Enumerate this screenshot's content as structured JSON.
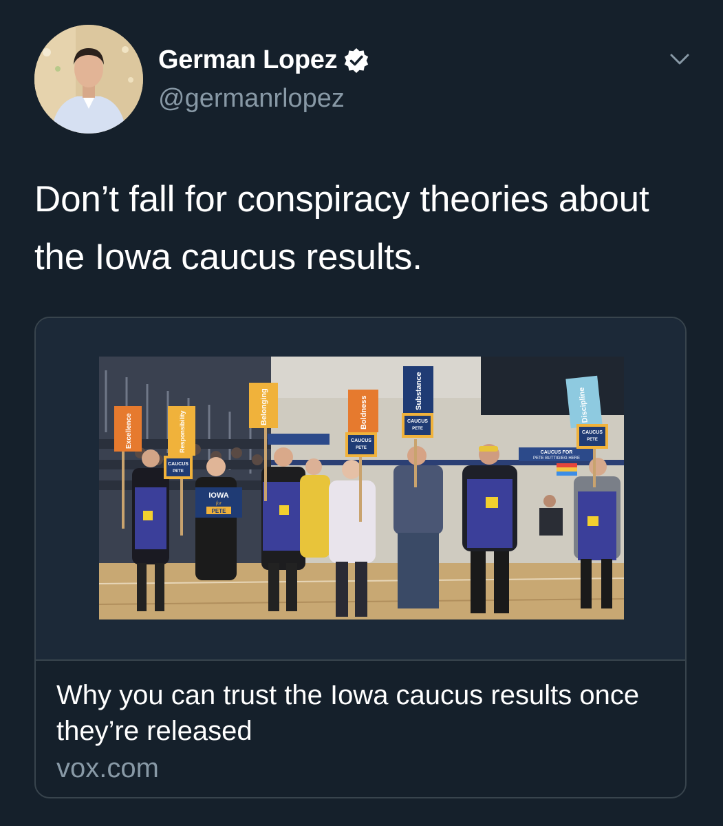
{
  "author": {
    "display_name": "German Lopez",
    "handle": "@germanrlopez",
    "verified": true,
    "avatar_icon": "profile-photo"
  },
  "tweet": {
    "text": "Don’t fall for conspiracy theories about the Iowa caucus results."
  },
  "card": {
    "title": "Why you can trust the Iowa caucus results once they’re released",
    "domain": "vox.com",
    "photo": {
      "sign_words": [
        "Excellence",
        "Responsibility",
        "Belonging",
        "Boldness",
        "Substance",
        "Discipline"
      ],
      "caucus_label": "CAUCUS",
      "pete_label": "PETE",
      "iowa_label": "IOWA",
      "for_label": "for",
      "banner_line1": "CAUCUS FOR",
      "banner_line2": "PETE BUTTIGIEG HERE"
    }
  },
  "colors": {
    "background": "#15202b",
    "card_border": "#38444d",
    "secondary_text": "#8899a6",
    "verified_badge": "#ffffff",
    "apron_blue": "#3b3f9a",
    "sign_orange": "#e67a2e",
    "sign_gold": "#f0b23b",
    "sign_navy": "#1f3b74",
    "sign_lightblue": "#8ecae0"
  }
}
